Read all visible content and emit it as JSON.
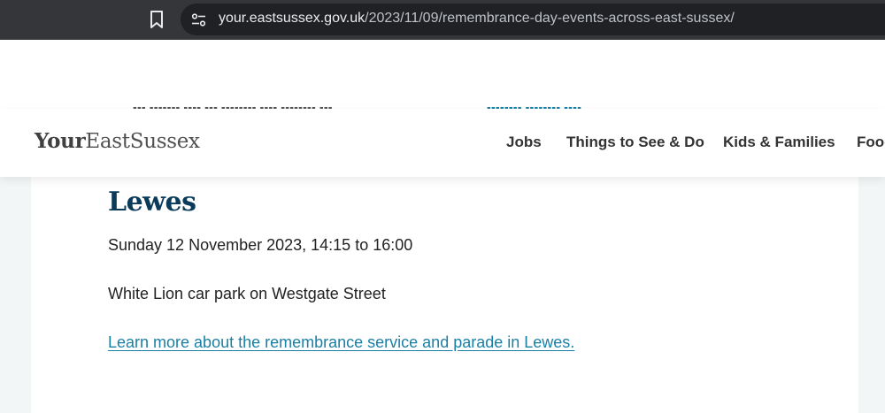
{
  "browser": {
    "url_host": "your.eastsussex.gov.uk",
    "url_path": "/2023/11/09/remembrance-day-events-across-east-sussex/",
    "icons": [
      "bookmark-icon",
      "site-info-icon"
    ]
  },
  "header": {
    "logo_bold": "Your",
    "logo_regular": "EastSussex",
    "nav": [
      "Jobs",
      "Things to See & Do",
      "Kids & Families",
      "Food"
    ]
  },
  "event": {
    "title": "Lewes",
    "date": "Sunday 12 November 2023, 14:15 to 16:00",
    "location": "White Lion car park on Westgate Street",
    "link": "Learn more about the remembrance service and parade in Lewes."
  },
  "colors": {
    "title": "#0b3b5b",
    "link": "#1a7fa6",
    "browser_bar": "#35363a",
    "page_background": "#f3f6f7"
  }
}
